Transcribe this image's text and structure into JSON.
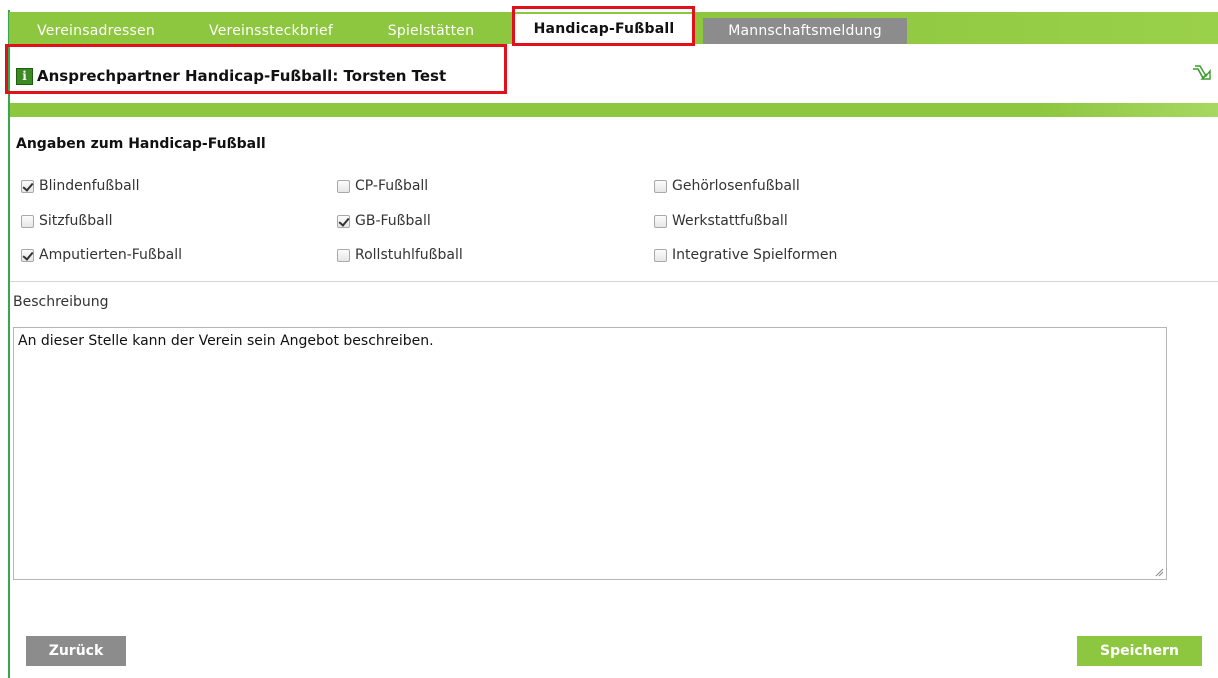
{
  "tabs": [
    {
      "label": "Vereinsadressen"
    },
    {
      "label": "Vereinssteckbrief"
    },
    {
      "label": "Spielstätten"
    },
    {
      "label": "Handicap-Fußball"
    },
    {
      "label": "Mannschaftsmeldung"
    }
  ],
  "contact": {
    "text": "Ansprechpartner Handicap-Fußball: Torsten Test"
  },
  "section": {
    "title": "Angaben zum Handicap-Fußball"
  },
  "options": [
    {
      "label": "Blindenfußball",
      "checked": true
    },
    {
      "label": "CP-Fußball",
      "checked": false
    },
    {
      "label": "Gehörlosenfußball",
      "checked": false
    },
    {
      "label": "Sitzfußball",
      "checked": false
    },
    {
      "label": "GB-Fußball",
      "checked": true
    },
    {
      "label": "Werkstattfußball",
      "checked": false
    },
    {
      "label": "Amputierten-Fußball",
      "checked": true
    },
    {
      "label": "Rollstuhlfußball",
      "checked": false
    },
    {
      "label": "Integrative Spielformen",
      "checked": false
    }
  ],
  "description": {
    "label": "Beschreibung",
    "value": "An dieser Stelle kann der Verein sein Angebot beschreiben."
  },
  "buttons": {
    "back": "Zurück",
    "save": "Speichern"
  },
  "colors": {
    "accent_green": "#8dc63f",
    "highlight_red": "#e0111b",
    "tab_gray": "#8c8c8c"
  }
}
